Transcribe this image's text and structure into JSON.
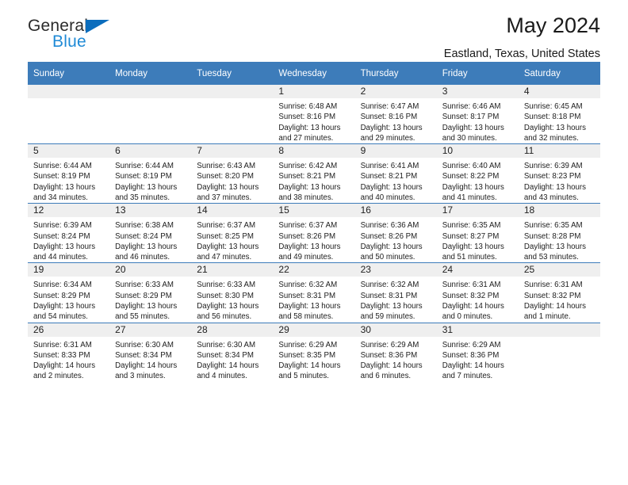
{
  "brand": {
    "name_primary": "General",
    "name_secondary": "Blue",
    "accent_color": "#1f8ad6",
    "triangle_color": "#0b6dbd"
  },
  "header": {
    "title": "May 2024",
    "subtitle": "Eastland, Texas, United States"
  },
  "theme": {
    "header_row_bg": "#3d7cba",
    "header_row_text": "#ffffff",
    "daynum_band_bg": "#efefef",
    "cell_bg": "#ffffff",
    "row_divider": "#3d7cba"
  },
  "calendar": {
    "weekday_headers": [
      "Sunday",
      "Monday",
      "Tuesday",
      "Wednesday",
      "Thursday",
      "Friday",
      "Saturday"
    ],
    "weeks": [
      [
        {
          "day": "",
          "empty": true
        },
        {
          "day": "",
          "empty": true
        },
        {
          "day": "",
          "empty": true
        },
        {
          "day": "1",
          "sunrise": "Sunrise: 6:48 AM",
          "sunset": "Sunset: 8:16 PM",
          "daylight_line1": "Daylight: 13 hours",
          "daylight_line2": "and 27 minutes."
        },
        {
          "day": "2",
          "sunrise": "Sunrise: 6:47 AM",
          "sunset": "Sunset: 8:16 PM",
          "daylight_line1": "Daylight: 13 hours",
          "daylight_line2": "and 29 minutes."
        },
        {
          "day": "3",
          "sunrise": "Sunrise: 6:46 AM",
          "sunset": "Sunset: 8:17 PM",
          "daylight_line1": "Daylight: 13 hours",
          "daylight_line2": "and 30 minutes."
        },
        {
          "day": "4",
          "sunrise": "Sunrise: 6:45 AM",
          "sunset": "Sunset: 8:18 PM",
          "daylight_line1": "Daylight: 13 hours",
          "daylight_line2": "and 32 minutes."
        }
      ],
      [
        {
          "day": "5",
          "sunrise": "Sunrise: 6:44 AM",
          "sunset": "Sunset: 8:19 PM",
          "daylight_line1": "Daylight: 13 hours",
          "daylight_line2": "and 34 minutes."
        },
        {
          "day": "6",
          "sunrise": "Sunrise: 6:44 AM",
          "sunset": "Sunset: 8:19 PM",
          "daylight_line1": "Daylight: 13 hours",
          "daylight_line2": "and 35 minutes."
        },
        {
          "day": "7",
          "sunrise": "Sunrise: 6:43 AM",
          "sunset": "Sunset: 8:20 PM",
          "daylight_line1": "Daylight: 13 hours",
          "daylight_line2": "and 37 minutes."
        },
        {
          "day": "8",
          "sunrise": "Sunrise: 6:42 AM",
          "sunset": "Sunset: 8:21 PM",
          "daylight_line1": "Daylight: 13 hours",
          "daylight_line2": "and 38 minutes."
        },
        {
          "day": "9",
          "sunrise": "Sunrise: 6:41 AM",
          "sunset": "Sunset: 8:21 PM",
          "daylight_line1": "Daylight: 13 hours",
          "daylight_line2": "and 40 minutes."
        },
        {
          "day": "10",
          "sunrise": "Sunrise: 6:40 AM",
          "sunset": "Sunset: 8:22 PM",
          "daylight_line1": "Daylight: 13 hours",
          "daylight_line2": "and 41 minutes."
        },
        {
          "day": "11",
          "sunrise": "Sunrise: 6:39 AM",
          "sunset": "Sunset: 8:23 PM",
          "daylight_line1": "Daylight: 13 hours",
          "daylight_line2": "and 43 minutes."
        }
      ],
      [
        {
          "day": "12",
          "sunrise": "Sunrise: 6:39 AM",
          "sunset": "Sunset: 8:24 PM",
          "daylight_line1": "Daylight: 13 hours",
          "daylight_line2": "and 44 minutes."
        },
        {
          "day": "13",
          "sunrise": "Sunrise: 6:38 AM",
          "sunset": "Sunset: 8:24 PM",
          "daylight_line1": "Daylight: 13 hours",
          "daylight_line2": "and 46 minutes."
        },
        {
          "day": "14",
          "sunrise": "Sunrise: 6:37 AM",
          "sunset": "Sunset: 8:25 PM",
          "daylight_line1": "Daylight: 13 hours",
          "daylight_line2": "and 47 minutes."
        },
        {
          "day": "15",
          "sunrise": "Sunrise: 6:37 AM",
          "sunset": "Sunset: 8:26 PM",
          "daylight_line1": "Daylight: 13 hours",
          "daylight_line2": "and 49 minutes."
        },
        {
          "day": "16",
          "sunrise": "Sunrise: 6:36 AM",
          "sunset": "Sunset: 8:26 PM",
          "daylight_line1": "Daylight: 13 hours",
          "daylight_line2": "and 50 minutes."
        },
        {
          "day": "17",
          "sunrise": "Sunrise: 6:35 AM",
          "sunset": "Sunset: 8:27 PM",
          "daylight_line1": "Daylight: 13 hours",
          "daylight_line2": "and 51 minutes."
        },
        {
          "day": "18",
          "sunrise": "Sunrise: 6:35 AM",
          "sunset": "Sunset: 8:28 PM",
          "daylight_line1": "Daylight: 13 hours",
          "daylight_line2": "and 53 minutes."
        }
      ],
      [
        {
          "day": "19",
          "sunrise": "Sunrise: 6:34 AM",
          "sunset": "Sunset: 8:29 PM",
          "daylight_line1": "Daylight: 13 hours",
          "daylight_line2": "and 54 minutes."
        },
        {
          "day": "20",
          "sunrise": "Sunrise: 6:33 AM",
          "sunset": "Sunset: 8:29 PM",
          "daylight_line1": "Daylight: 13 hours",
          "daylight_line2": "and 55 minutes."
        },
        {
          "day": "21",
          "sunrise": "Sunrise: 6:33 AM",
          "sunset": "Sunset: 8:30 PM",
          "daylight_line1": "Daylight: 13 hours",
          "daylight_line2": "and 56 minutes."
        },
        {
          "day": "22",
          "sunrise": "Sunrise: 6:32 AM",
          "sunset": "Sunset: 8:31 PM",
          "daylight_line1": "Daylight: 13 hours",
          "daylight_line2": "and 58 minutes."
        },
        {
          "day": "23",
          "sunrise": "Sunrise: 6:32 AM",
          "sunset": "Sunset: 8:31 PM",
          "daylight_line1": "Daylight: 13 hours",
          "daylight_line2": "and 59 minutes."
        },
        {
          "day": "24",
          "sunrise": "Sunrise: 6:31 AM",
          "sunset": "Sunset: 8:32 PM",
          "daylight_line1": "Daylight: 14 hours",
          "daylight_line2": "and 0 minutes."
        },
        {
          "day": "25",
          "sunrise": "Sunrise: 6:31 AM",
          "sunset": "Sunset: 8:32 PM",
          "daylight_line1": "Daylight: 14 hours",
          "daylight_line2": "and 1 minute."
        }
      ],
      [
        {
          "day": "26",
          "sunrise": "Sunrise: 6:31 AM",
          "sunset": "Sunset: 8:33 PM",
          "daylight_line1": "Daylight: 14 hours",
          "daylight_line2": "and 2 minutes."
        },
        {
          "day": "27",
          "sunrise": "Sunrise: 6:30 AM",
          "sunset": "Sunset: 8:34 PM",
          "daylight_line1": "Daylight: 14 hours",
          "daylight_line2": "and 3 minutes."
        },
        {
          "day": "28",
          "sunrise": "Sunrise: 6:30 AM",
          "sunset": "Sunset: 8:34 PM",
          "daylight_line1": "Daylight: 14 hours",
          "daylight_line2": "and 4 minutes."
        },
        {
          "day": "29",
          "sunrise": "Sunrise: 6:29 AM",
          "sunset": "Sunset: 8:35 PM",
          "daylight_line1": "Daylight: 14 hours",
          "daylight_line2": "and 5 minutes."
        },
        {
          "day": "30",
          "sunrise": "Sunrise: 6:29 AM",
          "sunset": "Sunset: 8:36 PM",
          "daylight_line1": "Daylight: 14 hours",
          "daylight_line2": "and 6 minutes."
        },
        {
          "day": "31",
          "sunrise": "Sunrise: 6:29 AM",
          "sunset": "Sunset: 8:36 PM",
          "daylight_line1": "Daylight: 14 hours",
          "daylight_line2": "and 7 minutes."
        },
        {
          "day": "",
          "empty": true
        }
      ]
    ]
  }
}
